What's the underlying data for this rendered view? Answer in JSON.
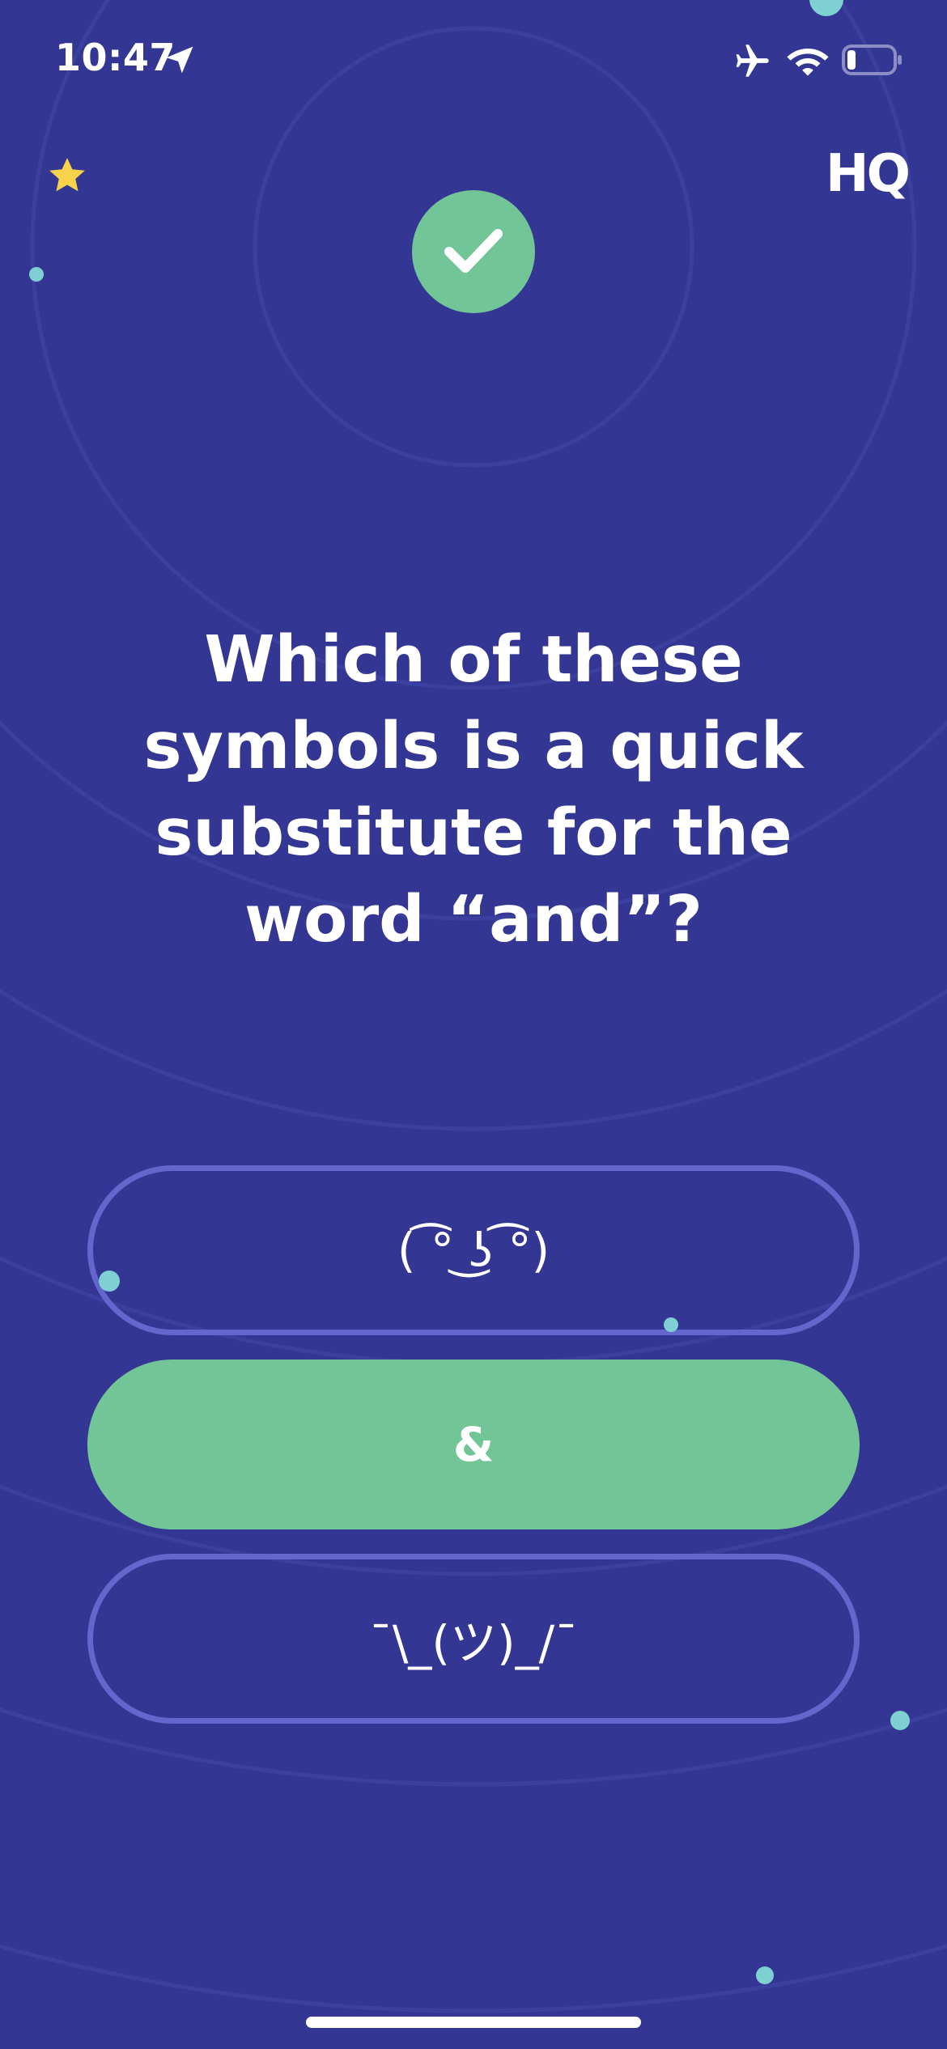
{
  "status_bar": {
    "time": "10:47",
    "icons": [
      "location-arrow-icon",
      "airplane-icon",
      "wifi-icon",
      "battery-icon"
    ]
  },
  "header": {
    "logo": "HQ",
    "star_icon": "star-icon",
    "result_icon": "checkmark-icon"
  },
  "question": {
    "text": "Which of these symbols is a quick substitute for the word “and”?"
  },
  "answers": [
    {
      "label": "( ͡° ͜ʖ ͡°)",
      "state": "not-selected"
    },
    {
      "label": "&",
      "state": "correct"
    },
    {
      "label": "¯\\_(ツ)_/¯",
      "state": "not-selected"
    }
  ],
  "colors": {
    "background": "#343694",
    "correct": "#72c597",
    "outline": "#6366cc",
    "dot": "#7fd0d3",
    "star": "#f6d34a"
  }
}
